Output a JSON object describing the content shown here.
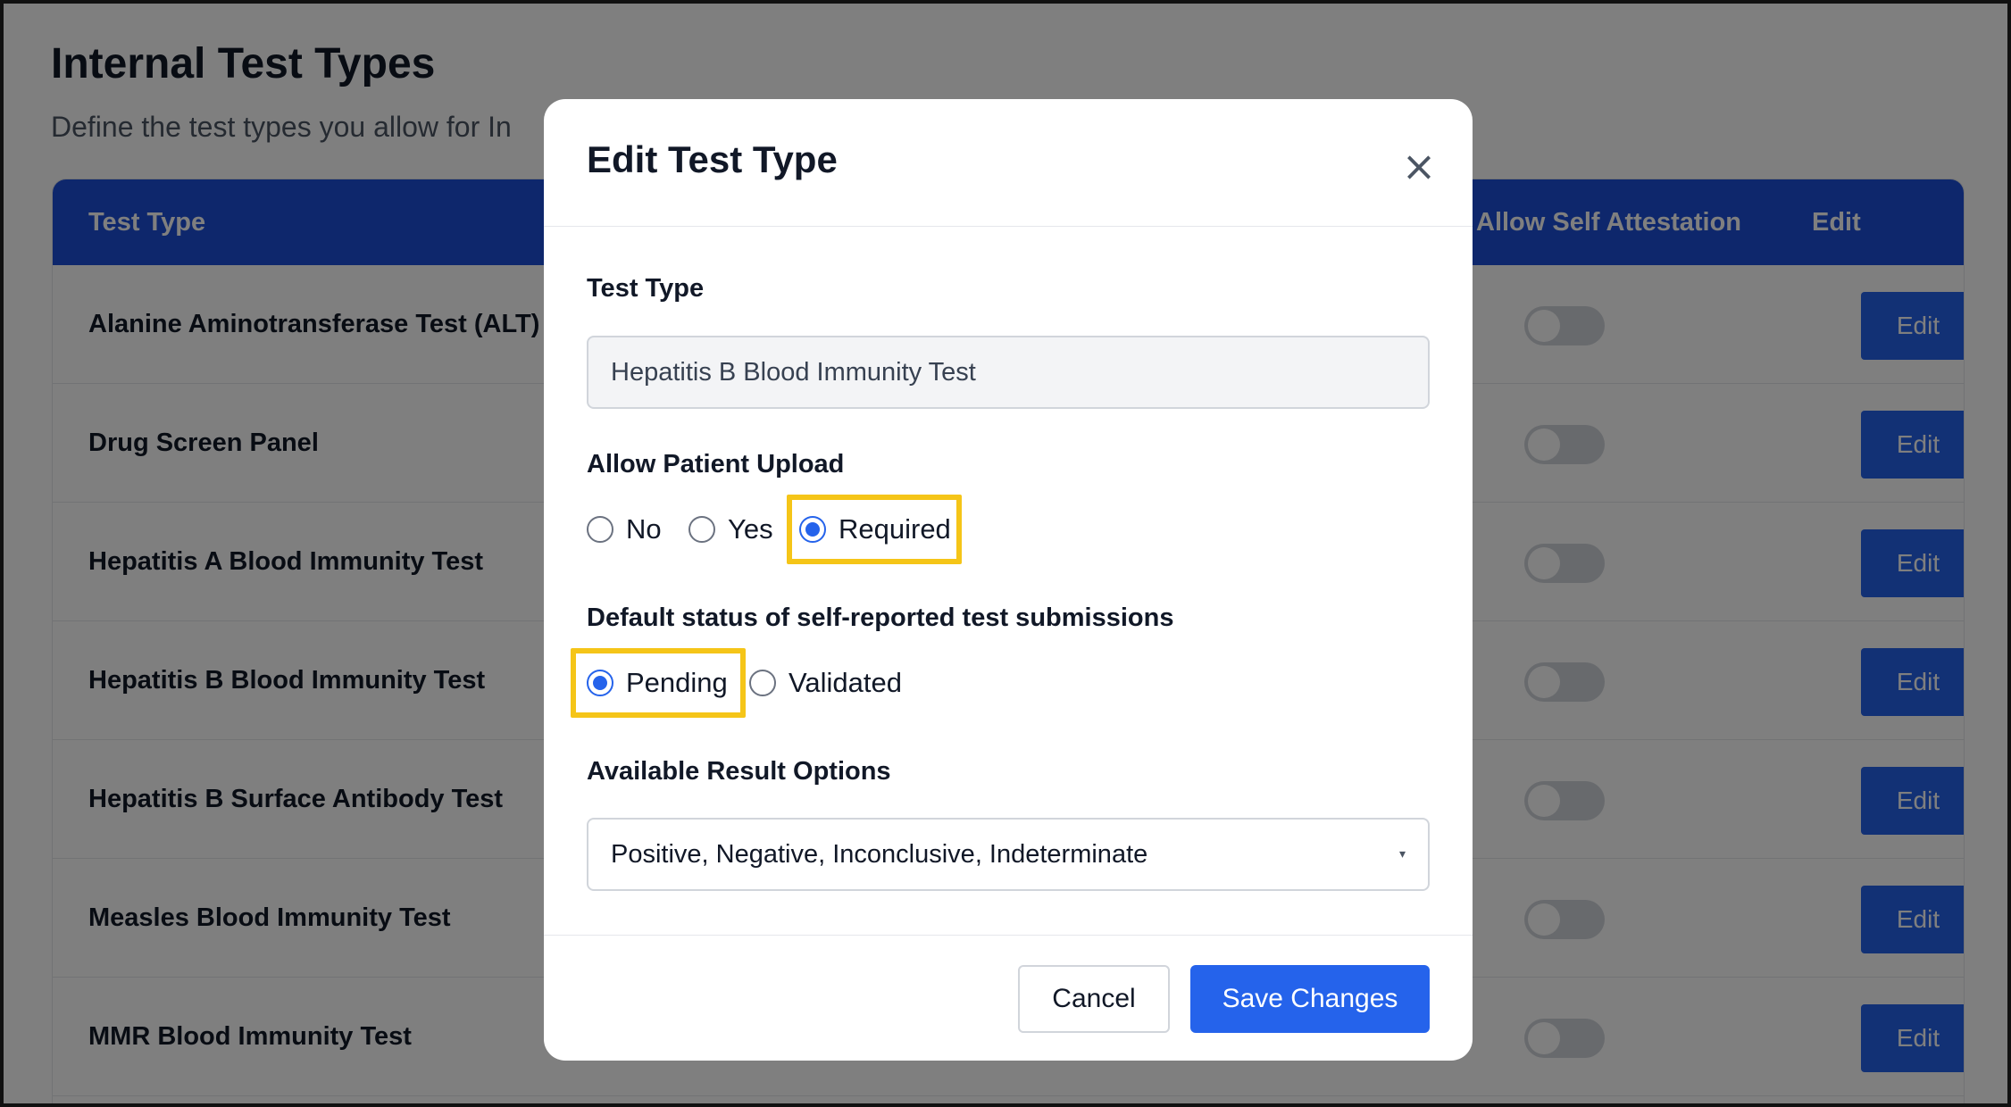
{
  "page": {
    "title": "Internal Test Types",
    "subtitle": "Define the test types you allow for In"
  },
  "table": {
    "headers": {
      "test_type": "Test Type",
      "allow_self_attestation": "Allow Self Attestation",
      "edit": "Edit"
    },
    "rows": [
      {
        "name": "Alanine Aminotransferase Test (ALT)",
        "edit_label": "Edit"
      },
      {
        "name": "Drug Screen Panel",
        "edit_label": "Edit"
      },
      {
        "name": "Hepatitis A Blood Immunity Test",
        "edit_label": "Edit"
      },
      {
        "name": "Hepatitis B Blood Immunity Test",
        "edit_label": "Edit"
      },
      {
        "name": "Hepatitis B Surface Antibody Test",
        "edit_label": "Edit"
      },
      {
        "name": "Measles Blood Immunity Test",
        "edit_label": "Edit"
      },
      {
        "name": "MMR Blood Immunity Test",
        "edit_label": "Edit"
      }
    ]
  },
  "modal": {
    "title": "Edit Test Type",
    "close_icon": "×",
    "test_type_label": "Test Type",
    "test_type_value": "Hepatitis B Blood Immunity Test",
    "allow_upload_label": "Allow Patient Upload",
    "allow_upload_options": [
      "No",
      "Yes",
      "Required"
    ],
    "allow_upload_selected": "Required",
    "default_status_label": "Default status of self-reported test submissions",
    "default_status_options": [
      "Pending",
      "Validated"
    ],
    "default_status_selected": "Pending",
    "result_options_label": "Available Result Options",
    "result_options_value": "Positive, Negative, Inconclusive, Indeterminate",
    "dropdown_icon": "▾",
    "cancel_label": "Cancel",
    "save_label": "Save Changes"
  },
  "colors": {
    "primary": "#2563eb",
    "header_blue": "#1d4ed8",
    "highlight": "#f5c518"
  }
}
